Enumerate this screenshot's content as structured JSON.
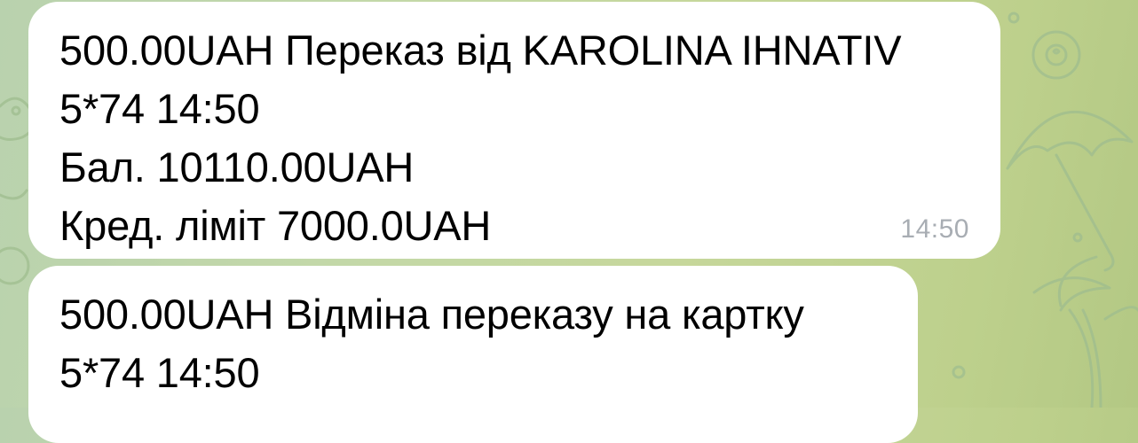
{
  "theme": {
    "bubble_color": "#ffffff",
    "text_color": "#000000",
    "time_color": "#a8adb3",
    "wallpaper_color": "#c3d8a9",
    "wallpaper_doodle_color": "#9fbd8f"
  },
  "wallpaper": {
    "doodles": [
      "billiard-ball-icon",
      "umbrella-icon",
      "palm-tree-icon",
      "frog-icon",
      "circle-doodle-icon"
    ]
  },
  "messages": [
    {
      "lines": [
        "500.00UAH Переказ від KAROLINA IHNATIV",
        "5*74 14:50",
        "Бал. 10110.00UAH",
        "Кред. ліміт 7000.0UAH"
      ],
      "time": "14:50"
    },
    {
      "lines": [
        "500.00UAH Відміна переказу на картку",
        "5*74 14:50"
      ]
    }
  ]
}
